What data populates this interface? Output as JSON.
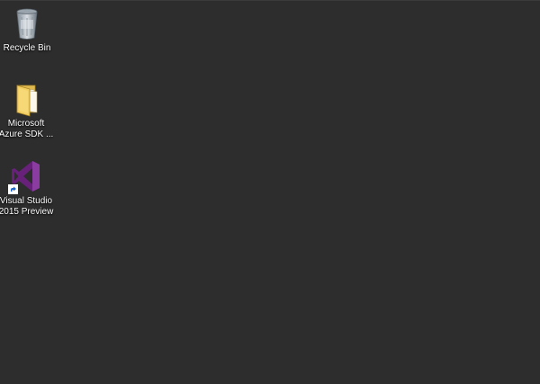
{
  "desktop": {
    "background_color": "#2d2d2d",
    "icons": [
      {
        "label": "Recycle Bin",
        "icon": "recycle-bin-icon"
      },
      {
        "label": "Microsoft Azure SDK ...",
        "icon": "folder-icon"
      },
      {
        "label": "Visual Studio 2015 Preview",
        "icon": "visual-studio-icon",
        "shortcut": true
      }
    ]
  }
}
